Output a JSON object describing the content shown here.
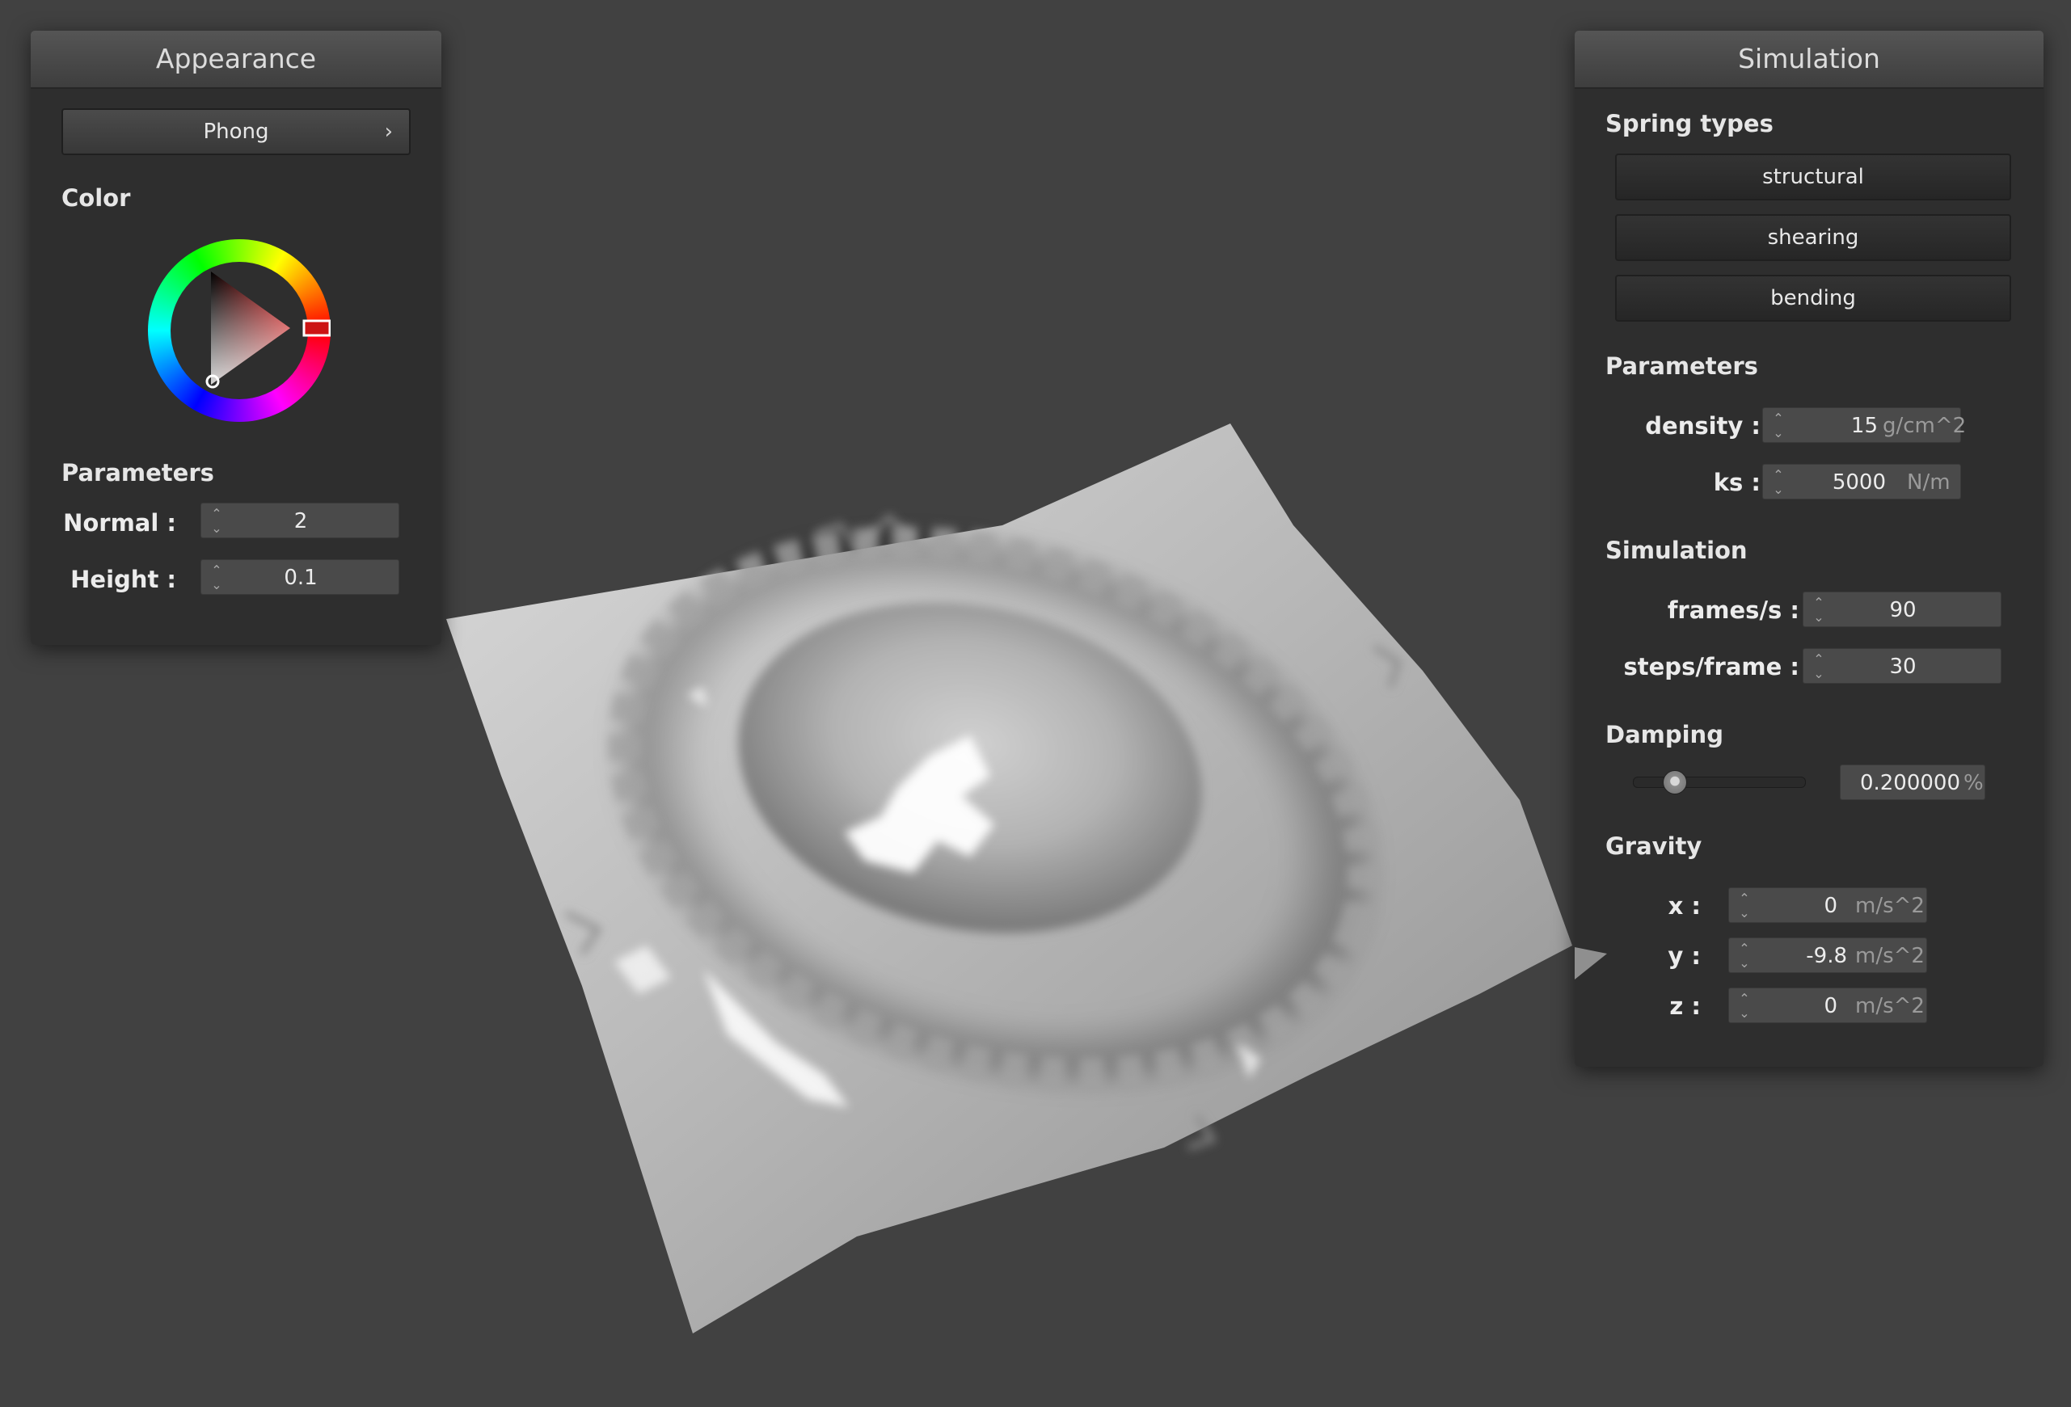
{
  "appearance": {
    "title": "Appearance",
    "shader_mode": "Phong",
    "color_label": "Color",
    "color_value": "#cc1414",
    "parameters_label": "Parameters",
    "normal": {
      "label": "Normal :",
      "value": "2"
    },
    "height": {
      "label": "Height :",
      "value": "0.1"
    }
  },
  "simulation": {
    "title": "Simulation",
    "spring_types_label": "Spring types",
    "spring_types": [
      {
        "label": "structural"
      },
      {
        "label": "shearing"
      },
      {
        "label": "bending"
      }
    ],
    "parameters_label": "Parameters",
    "density": {
      "label": "density :",
      "value": "15",
      "unit": "g/cm^2"
    },
    "ks": {
      "label": "ks :",
      "value": "5000",
      "unit": "N/m"
    },
    "simulation_label": "Simulation",
    "frames_per_sec": {
      "label": "frames/s :",
      "value": "90"
    },
    "steps_per_frame": {
      "label": "steps/frame :",
      "value": "30"
    },
    "damping_label": "Damping",
    "damping": {
      "value": "0.200000",
      "unit": "%",
      "slider_fraction": 0.2
    },
    "gravity_label": "Gravity",
    "gravity": [
      {
        "label": "x :",
        "value": "0",
        "unit": "m/s^2"
      },
      {
        "label": "y :",
        "value": "-9.8",
        "unit": "m/s^2"
      },
      {
        "label": "z :",
        "value": "0",
        "unit": "m/s^2"
      }
    ]
  },
  "colors": {
    "background": "#414141",
    "panel": "#2e2e2e",
    "cloth": "#c8c8c8"
  }
}
